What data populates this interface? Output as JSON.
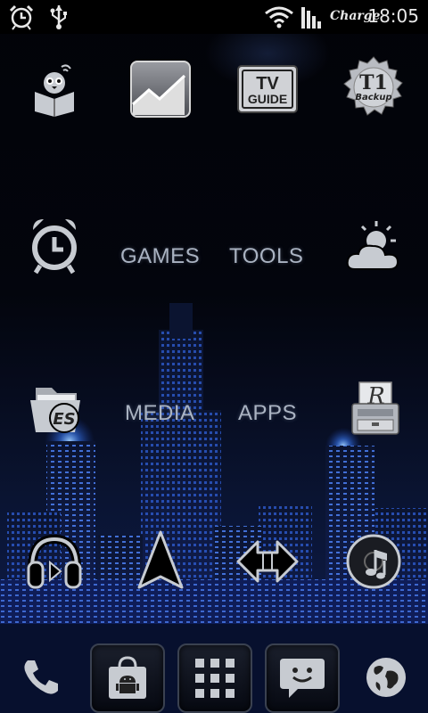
{
  "status_bar": {
    "time": "18:05",
    "charge_label": "Charge",
    "icons": [
      "alarm-icon",
      "usb-icon",
      "wifi-icon",
      "signal-icon"
    ]
  },
  "apps_row1": [
    {
      "name": "reader-app-icon"
    },
    {
      "name": "stocks-chart-app-icon"
    },
    {
      "name": "tv-guide-app-icon",
      "text": "TV GUIDE"
    },
    {
      "name": "titanium-backup-app-icon",
      "text_main": "T1",
      "text_sub": "Backup"
    }
  ],
  "folders": {
    "games": "GAMES",
    "tools": "TOOLS",
    "media": "MEDIA",
    "apps": "APPS"
  },
  "es_app": {
    "text": "ES"
  },
  "rom_app": {
    "text": "R"
  },
  "colors": {
    "label": "#aab3c2",
    "icon_fill": "#c7cbd1",
    "skyline_light": "#3f77ff",
    "background": "#000000"
  }
}
